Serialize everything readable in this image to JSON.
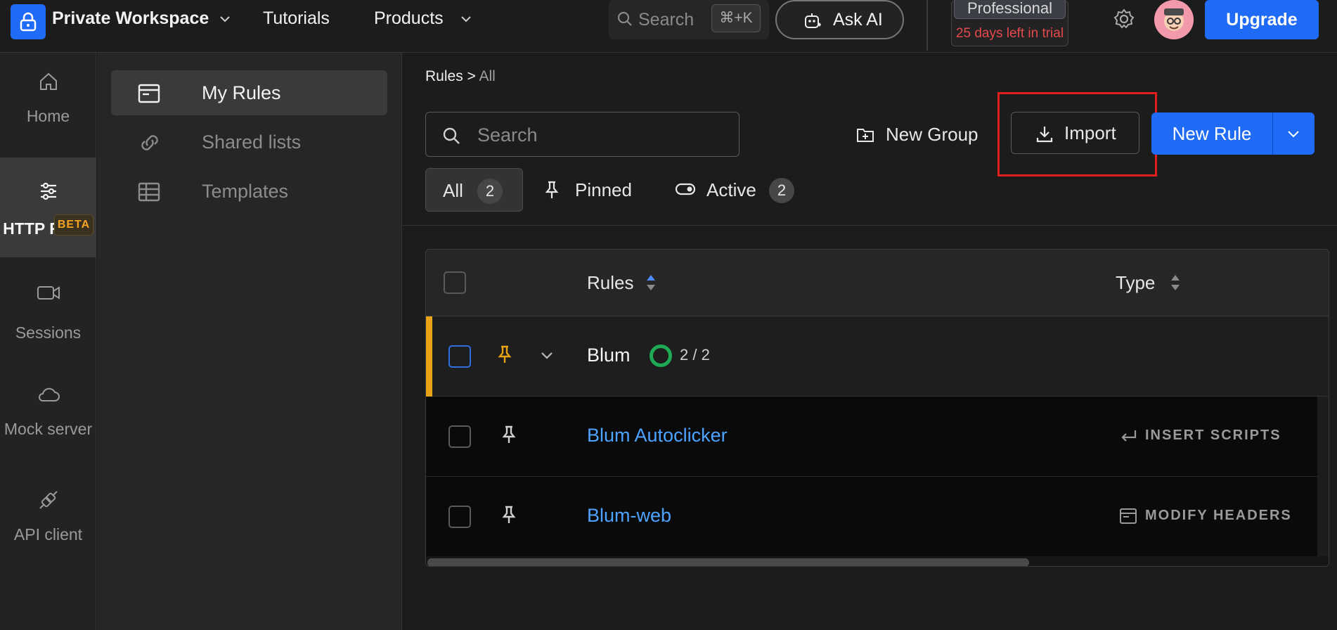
{
  "topbar": {
    "workspace_name": "Private Workspace",
    "tutorials_label": "Tutorials",
    "products_label": "Products",
    "search_placeholder": "Search",
    "search_shortcut": "⌘+K",
    "ask_ai_label": "Ask AI",
    "plan_name": "Professional",
    "trial_text": "25 days left in trial",
    "upgrade_label": "Upgrade"
  },
  "leftnav": {
    "items": [
      {
        "label": "Home",
        "icon": "home-icon"
      },
      {
        "label": "HTTP Rules",
        "icon": "sliders-icon",
        "active": true
      },
      {
        "label": "Sessions",
        "icon": "video-icon",
        "badge": "BETA"
      },
      {
        "label": "Mock server",
        "icon": "cloud-icon"
      },
      {
        "label": "API client",
        "icon": "plug-icon"
      }
    ]
  },
  "sidebar": {
    "items": [
      {
        "label": "My Rules",
        "icon": "browser-window-icon",
        "active": true
      },
      {
        "label": "Shared lists",
        "icon": "link-icon"
      },
      {
        "label": "Templates",
        "icon": "table-icon"
      }
    ]
  },
  "main": {
    "breadcrumb_root": "Rules",
    "breadcrumb_sep": ">",
    "breadcrumb_current": "All",
    "search_placeholder": "Search",
    "new_group_label": "New Group",
    "import_label": "Import",
    "new_rule_label": "New Rule",
    "filters": [
      {
        "label": "All",
        "count": "2",
        "active": true
      },
      {
        "label": "Pinned"
      },
      {
        "label": "Active",
        "count": "2"
      }
    ],
    "table": {
      "columns": [
        "Rules",
        "Type"
      ],
      "group": {
        "name": "Blum",
        "active_count": "2 / 2",
        "accent_color": "#e8a317"
      },
      "rows": [
        {
          "name": "Blum Autoclicker",
          "type": "INSERT SCRIPTS",
          "type_icon": "return-arrow-icon"
        },
        {
          "name": "Blum-web",
          "type": "MODIFY HEADERS",
          "type_icon": "browser-window-icon"
        }
      ]
    }
  },
  "colors": {
    "accent_blue": "#1f6bf5",
    "link_blue": "#4da3ff",
    "trial_red": "#e5484d",
    "highlight_red": "#e0201e",
    "active_green": "#1faa55"
  }
}
